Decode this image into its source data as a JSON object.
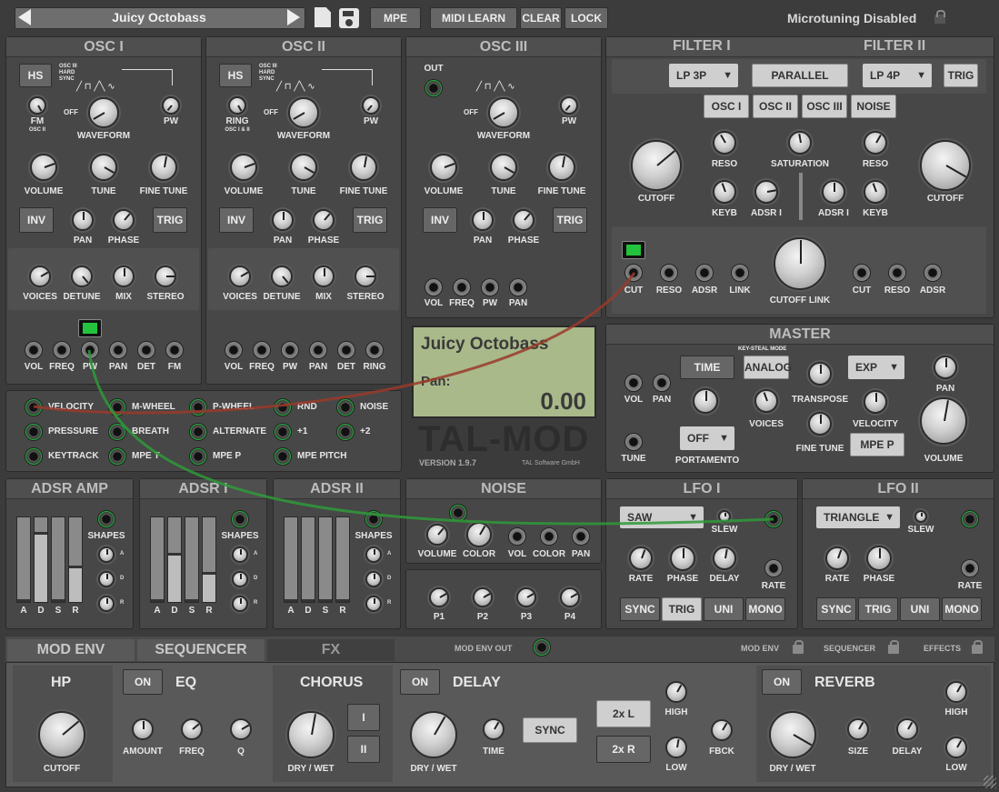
{
  "header": {
    "preset": "Juicy Octobass",
    "mpe": "MPE",
    "midi_learn": "MIDI LEARN",
    "clear": "CLEAR",
    "lock": "LOCK",
    "microtuning": "Microtuning Disabled"
  },
  "osc1": {
    "title": "OSC I",
    "hs": "HS",
    "sync": [
      "OSC III",
      "HARD",
      "SYNC"
    ],
    "fm": "FM",
    "fm_sub": "OSC II",
    "waveform": "WAVEFORM",
    "off": "OFF",
    "pw": "PW",
    "volume": "VOLUME",
    "tune": "TUNE",
    "fine_tune": "FINE TUNE",
    "inv": "INV",
    "pan": "PAN",
    "phase": "PHASE",
    "trig": "TRIG",
    "voices": "VOICES",
    "detune": "DETUNE",
    "mix": "MIX",
    "stereo": "STEREO",
    "jacks": [
      "VOL",
      "FREQ",
      "PW",
      "PAN",
      "DET",
      "FM"
    ]
  },
  "osc2": {
    "title": "OSC II",
    "hs": "HS",
    "sync": [
      "OSC III",
      "HARD",
      "SYNC"
    ],
    "ring": "RING",
    "ring_sub": "OSC I & II",
    "waveform": "WAVEFORM",
    "off": "OFF",
    "pw": "PW",
    "volume": "VOLUME",
    "tune": "TUNE",
    "fine_tune": "FINE TUNE",
    "inv": "INV",
    "pan": "PAN",
    "phase": "PHASE",
    "trig": "TRIG",
    "voices": "VOICES",
    "detune": "DETUNE",
    "mix": "MIX",
    "stereo": "STEREO",
    "jacks": [
      "VOL",
      "FREQ",
      "PW",
      "PAN",
      "DET",
      "RING"
    ]
  },
  "osc3": {
    "title": "OSC III",
    "out": "OUT",
    "waveform": "WAVEFORM",
    "off": "OFF",
    "pw": "PW",
    "volume": "VOLUME",
    "tune": "TUNE",
    "fine_tune": "FINE TUNE",
    "inv": "INV",
    "pan": "PAN",
    "phase": "PHASE",
    "trig": "TRIG",
    "jacks": [
      "VOL",
      "FREQ",
      "PW",
      "PAN"
    ]
  },
  "filter": {
    "title1": "FILTER I",
    "title2": "FILTER II",
    "type1": "LP 3P",
    "routing": "PARALLEL",
    "type2": "LP 4P",
    "trig": "TRIG",
    "sources": [
      "OSC I",
      "OSC II",
      "OSC III",
      "NOISE"
    ],
    "reso": "RESO",
    "saturation": "SATURATION",
    "cutoff": "CUTOFF",
    "keyb": "KEYB",
    "adsr1": "ADSR I",
    "cutoff_link": "CUTOFF LINK",
    "jacks1": [
      "CUT",
      "RESO",
      "ADSR",
      "LINK"
    ],
    "jacks2": [
      "CUT",
      "RESO",
      "ADSR"
    ]
  },
  "sources": {
    "items": [
      "VELOCITY",
      "M-WHEEL",
      "P-WHEEL",
      "RND",
      "NOISE",
      "PRESSURE",
      "BREATH",
      "ALTERNATE",
      "+1",
      "+2",
      "KEYTRACK",
      "MPE T",
      "MPE P",
      "MPE PITCH"
    ]
  },
  "display": {
    "preset": "Juicy Octobass",
    "param": "Pan:",
    "value": "0.00",
    "logo": "TAL-MOD",
    "version": "VERSION 1.9.7",
    "company": "TAL Software GmbH"
  },
  "master": {
    "title": "MASTER",
    "vol": "VOL",
    "pan": "PAN",
    "time": "TIME",
    "key_steal": "KEY-STEAL MODE",
    "analog": "ANALOG",
    "transpose": "TRANSPOSE",
    "exp": "EXP",
    "pan2": "PAN",
    "voices": "VOICES",
    "velocity": "VELOCITY",
    "tune": "TUNE",
    "off": "OFF",
    "portamento": "PORTAMENTO",
    "fine_tune": "FINE TUNE",
    "mpe_p": "MPE P",
    "volume": "VOLUME"
  },
  "adsr_amp": {
    "title": "ADSR AMP",
    "shapes": "SHAPES",
    "letters": [
      "A",
      "D",
      "S",
      "R"
    ],
    "shape_letters": [
      "A",
      "D",
      "R"
    ],
    "values": [
      0.0,
      0.8,
      0.0,
      0.4
    ]
  },
  "adsr1": {
    "title": "ADSR I",
    "shapes": "SHAPES",
    "letters": [
      "A",
      "D",
      "S",
      "R"
    ],
    "shape_letters": [
      "A",
      "D",
      "R"
    ],
    "values": [
      0.0,
      0.55,
      0.0,
      0.32
    ]
  },
  "adsr2": {
    "title": "ADSR II",
    "shapes": "SHAPES",
    "letters": [
      "A",
      "D",
      "S",
      "R"
    ],
    "shape_letters": [
      "A",
      "D",
      "R"
    ],
    "values": [
      0.0,
      0.0,
      0.0,
      0.0
    ]
  },
  "noise": {
    "title": "NOISE",
    "volume": "VOLUME",
    "color": "COLOR",
    "jacks": [
      "VOL",
      "COLOR",
      "PAN"
    ],
    "p": [
      "P1",
      "P2",
      "P3",
      "P4"
    ]
  },
  "lfo1": {
    "title": "LFO I",
    "wave": "SAW",
    "slew": "SLEW",
    "rate": "RATE",
    "phase": "PHASE",
    "delay": "DELAY",
    "rate2": "RATE",
    "buttons": [
      "SYNC",
      "TRIG",
      "UNI",
      "MONO"
    ]
  },
  "lfo2": {
    "title": "LFO II",
    "wave": "TRIANGLE",
    "slew": "SLEW",
    "rate": "RATE",
    "phase": "PHASE",
    "rate2": "RATE",
    "buttons": [
      "SYNC",
      "TRIG",
      "UNI",
      "MONO"
    ]
  },
  "tabs": {
    "mod_env": "MOD ENV",
    "sequencer": "SEQUENCER",
    "fx": "FX",
    "mod_env_out": "MOD ENV OUT",
    "lock_mod": "MOD ENV",
    "lock_seq": "SEQUENCER",
    "lock_fx": "EFFECTS"
  },
  "fx": {
    "hp": "HP",
    "cutoff": "CUTOFF",
    "on": "ON",
    "eq": "EQ",
    "amount": "AMOUNT",
    "freq": "FREQ",
    "q": "Q",
    "chorus": "CHORUS",
    "dry_wet": "DRY / WET",
    "ch1": "I",
    "ch2": "II",
    "delay": "DELAY",
    "time": "TIME",
    "sync": "SYNC",
    "twoxl": "2x L",
    "twoxr": "2x R",
    "high": "HIGH",
    "low": "LOW",
    "fbck": "FBCK",
    "reverb": "REVERB",
    "size": "SIZE",
    "rdelay": "DELAY"
  },
  "colors": {
    "led": "#23c33e",
    "cable_red": "#9a3a2a",
    "cable_green": "#2f9a3a",
    "display_bg": "#a9b98a"
  }
}
